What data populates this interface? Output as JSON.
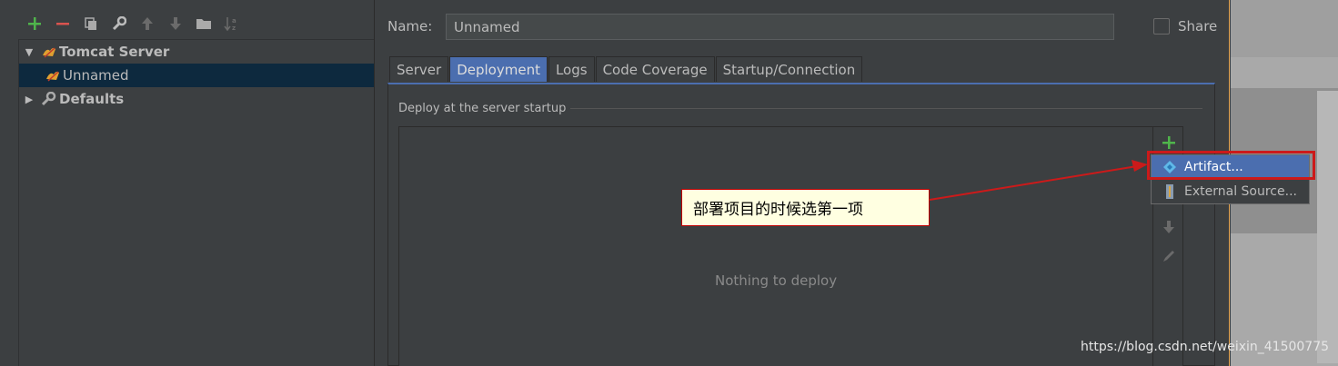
{
  "left": {
    "tree": [
      {
        "label": "Tomcat Server"
      },
      {
        "label": "Unnamed"
      },
      {
        "label": "Defaults"
      }
    ]
  },
  "right": {
    "name_label": "Name:",
    "name_value": "Unnamed",
    "share_label": "Share",
    "tabs": [
      "Server",
      "Deployment",
      "Logs",
      "Code Coverage",
      "Startup/Connection"
    ],
    "group_title": "Deploy at the server startup",
    "empty_text": "Nothing to deploy"
  },
  "popup": {
    "items": [
      "Artifact...",
      "External Source..."
    ]
  },
  "callout": "部署项目的时候选第一项",
  "watermark": "https://blog.csdn.net/weixin_41500775",
  "colors": {
    "add": "#4fb54b",
    "remove": "#d9534f",
    "selection": "#4b6eaf",
    "annotation": "#cc1a1a"
  }
}
